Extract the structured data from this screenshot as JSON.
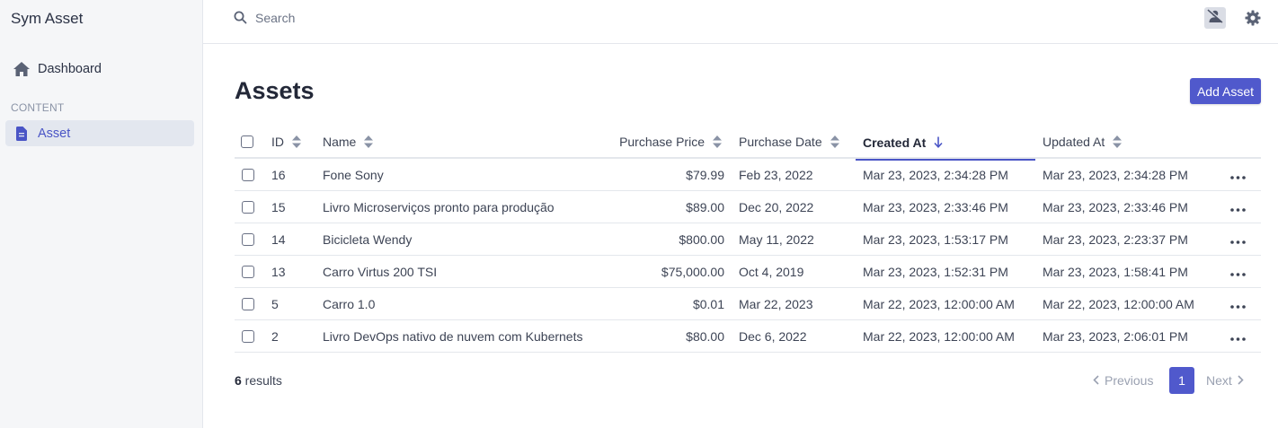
{
  "app": {
    "title": "Sym Asset"
  },
  "sidebar": {
    "dashboard_label": "Dashboard",
    "section_label": "CONTENT",
    "asset_label": "Asset"
  },
  "search": {
    "placeholder": "Search",
    "value": ""
  },
  "page": {
    "title": "Assets",
    "add_label": "Add Asset"
  },
  "table": {
    "columns": {
      "id": "ID",
      "name": "Name",
      "price": "Purchase Price",
      "purchase_date": "Purchase Date",
      "created": "Created At",
      "updated": "Updated At"
    },
    "sorted_by": "Created At",
    "sort_direction": "descending",
    "rows": [
      {
        "id": "16",
        "name": "Fone Sony",
        "price": "$79.99",
        "purchase_date": "Feb 23, 2022",
        "created": "Mar 23, 2023, 2:34:28 PM",
        "updated": "Mar 23, 2023, 2:34:28 PM"
      },
      {
        "id": "15",
        "name": "Livro Microserviços pronto para produção",
        "price": "$89.00",
        "purchase_date": "Dec 20, 2022",
        "created": "Mar 23, 2023, 2:33:46 PM",
        "updated": "Mar 23, 2023, 2:33:46 PM"
      },
      {
        "id": "14",
        "name": "Bicicleta Wendy",
        "price": "$800.00",
        "purchase_date": "May 11, 2022",
        "created": "Mar 23, 2023, 1:53:17 PM",
        "updated": "Mar 23, 2023, 2:23:37 PM"
      },
      {
        "id": "13",
        "name": "Carro Virtus 200 TSI",
        "price": "$75,000.00",
        "purchase_date": "Oct 4, 2019",
        "created": "Mar 23, 2023, 1:52:31 PM",
        "updated": "Mar 23, 2023, 1:58:41 PM"
      },
      {
        "id": "5",
        "name": "Carro 1.0",
        "price": "$0.01",
        "purchase_date": "Mar 22, 2023",
        "created": "Mar 22, 2023, 12:00:00 AM",
        "updated": "Mar 22, 2023, 12:00:00 AM"
      },
      {
        "id": "2",
        "name": "Livro DevOps nativo de nuvem com Kubernets",
        "price": "$80.00",
        "purchase_date": "Dec 6, 2022",
        "created": "Mar 22, 2023, 12:00:00 AM",
        "updated": "Mar 23, 2023, 2:06:01 PM"
      }
    ]
  },
  "footer": {
    "results_count": "6",
    "results_label": " results",
    "prev_label": "Previous",
    "page": "1",
    "next_label": "Next"
  },
  "icons": {
    "dashboard": "home-icon",
    "asset": "document-icon",
    "search": "search-icon",
    "user": "user-slash-icon",
    "settings": "gear-icon",
    "more": "ellipsis-icon"
  },
  "colors": {
    "accent": "#5059cc",
    "active_nav_bg": "#e3e7ef",
    "sidebar_bg": "#f5f6f8"
  }
}
